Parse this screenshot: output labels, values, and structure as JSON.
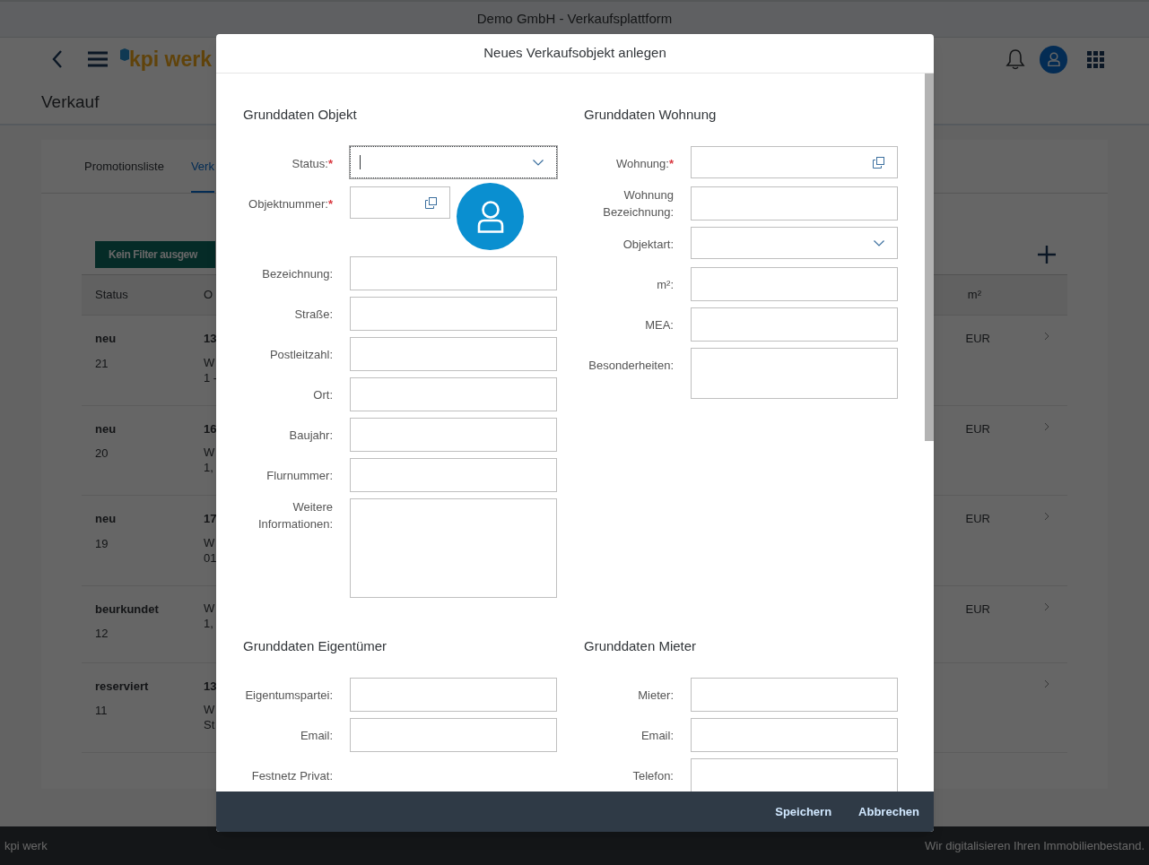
{
  "app": {
    "title": "Demo GmbH - Verkaufsplattform",
    "logo": "kpi werk",
    "page_title": "Verkauf"
  },
  "tabs": [
    {
      "label": "Promotionsliste",
      "selected": false
    },
    {
      "label": "Verk",
      "selected": true
    }
  ],
  "filter_button": "Kein Filter ausgew",
  "table": {
    "columns": [
      "Status",
      "O"
    ],
    "column_right": "m²",
    "rows": [
      {
        "status": "neu",
        "number": "21",
        "column_2": {
          "title": "13",
          "lines": [
            "W",
            "1 -"
          ]
        },
        "column_right": "EUR"
      },
      {
        "status": "neu",
        "number": "20",
        "column_2": {
          "title": "16",
          "lines": [
            "W",
            "1,"
          ]
        },
        "column_right": "EUR"
      },
      {
        "status": "neu",
        "number": "19",
        "column_2": {
          "title": "17",
          "lines": [
            "W",
            "01"
          ]
        },
        "column_right": "EUR"
      },
      {
        "status": "beurkundet",
        "number": "12",
        "column_2": {
          "lines": [
            "W",
            "1,"
          ]
        },
        "column_right": "EUR"
      },
      {
        "status": "reserviert",
        "number": "11",
        "column_2": {
          "title": "13",
          "lines": [
            "W",
            "St"
          ]
        }
      }
    ]
  },
  "dialog": {
    "title": "Neues Verkaufsobjekt anlegen",
    "sections": [
      {
        "heading": "Grunddaten Objekt",
        "fields": [
          {
            "label": "Status:",
            "required_marker": "*",
            "kind": "dropdown",
            "focused": true
          },
          {
            "label": "Objektnummer:",
            "required_marker": "*",
            "kind": "valuehelp",
            "focused": false,
            "avatar": true
          },
          {
            "label": "Bezeichnung:",
            "kind": "input",
            "focused": false
          },
          {
            "label": "Straße:",
            "kind": "input",
            "focused": false
          },
          {
            "label": "Postleitzahl:",
            "kind": "input",
            "focused": false
          },
          {
            "label": "Ort:",
            "kind": "input",
            "focused": false
          },
          {
            "label": "Baujahr:",
            "kind": "input",
            "focused": false
          },
          {
            "label": "Flurnummer:",
            "kind": "input",
            "focused": false
          },
          {
            "label": "Weitere Informationen:",
            "kind": "textarea",
            "focused": false
          }
        ]
      },
      {
        "heading": "Grunddaten Wohnung",
        "fields": [
          {
            "label": "Wohnung:",
            "required_marker": "*",
            "kind": "valuehelp",
            "focused": false
          },
          {
            "label": "Wohnung Bezeichnung:",
            "kind": "input",
            "focused": false
          },
          {
            "label": "Objektart:",
            "kind": "dropdown",
            "focused": false
          },
          {
            "label": "m²:",
            "kind": "input",
            "focused": false
          },
          {
            "label": "MEA:",
            "kind": "input",
            "focused": false
          },
          {
            "label": "Besonderheiten:",
            "kind": "memo",
            "focused": false
          }
        ]
      },
      {
        "heading": "Grunddaten Eigentümer",
        "fields": [
          {
            "label": "Eigentumspartei:",
            "kind": "input",
            "focused": false
          },
          {
            "label": "Email:",
            "kind": "input",
            "focused": false
          },
          {
            "label": "Festnetz Privat:",
            "kind": "none"
          }
        ]
      },
      {
        "heading": "Grunddaten Mieter",
        "fields": [
          {
            "label": "Mieter:",
            "kind": "input",
            "focused": false
          },
          {
            "label": "Email:",
            "kind": "input",
            "focused": false
          },
          {
            "label": "Telefon:",
            "kind": "input",
            "focused": false
          }
        ]
      }
    ],
    "buttons": [
      "Speichern",
      "Abbrechen"
    ]
  },
  "footer": {
    "left": "kpi werk",
    "right": "Wir digitalisieren Ihren Immobilienbestand."
  }
}
